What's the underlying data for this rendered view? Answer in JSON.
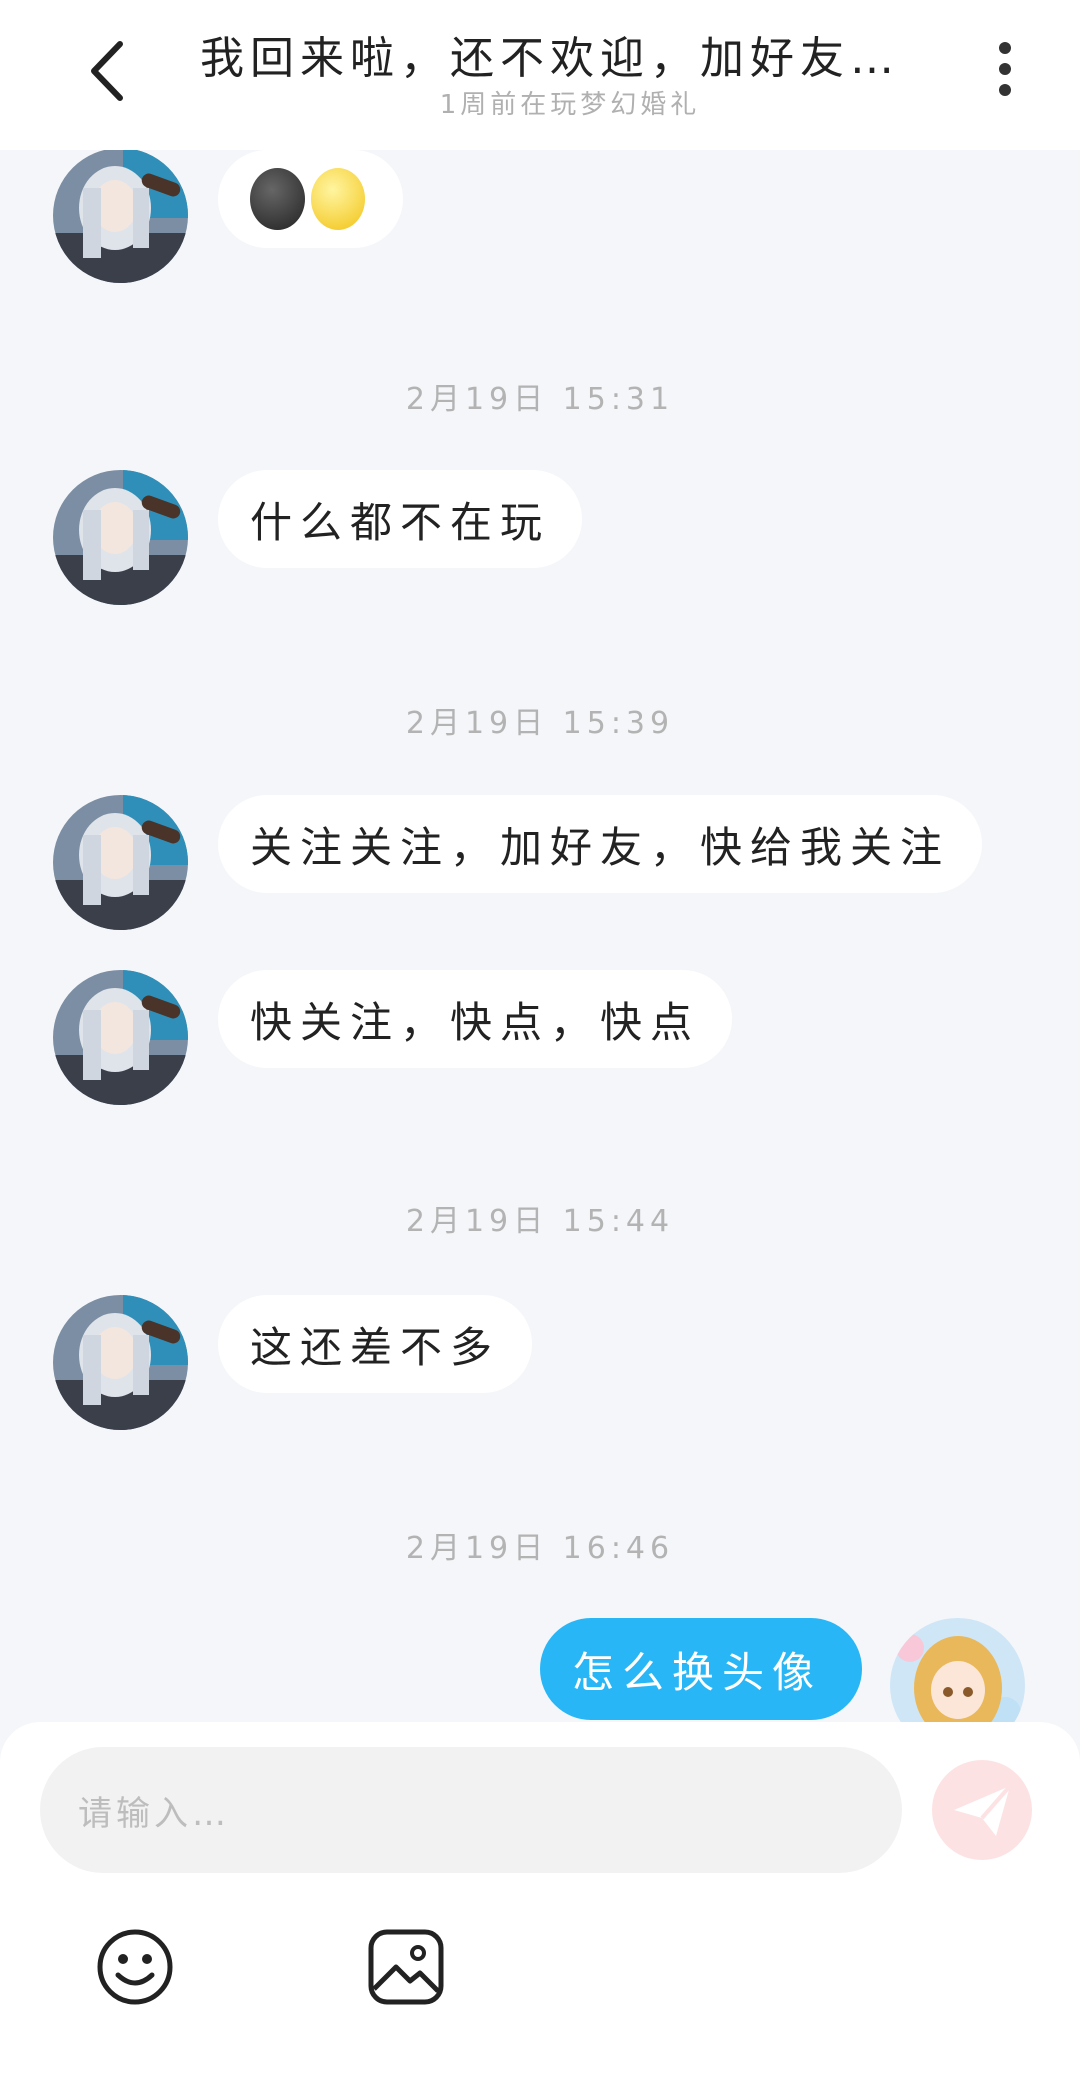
{
  "header": {
    "title": "我回来啦，还不欢迎，加好友要…",
    "subtitle": "1周前在玩梦幻婚礼"
  },
  "messages": {
    "m0": {
      "emoji": [
        "🌚",
        "🌝"
      ]
    },
    "t1": "2月19日 15:31",
    "m1": "什么都不在玩",
    "t2": "2月19日 15:39",
    "m2": "关注关注，加好友，快给我关注",
    "m3": "快关注，快点，快点",
    "t3": "2月19日 15:44",
    "m4": "这还差不多",
    "t4": "2月19日 16:46",
    "m5": "怎么换头像"
  },
  "composer": {
    "placeholder": "请输入…"
  },
  "colors": {
    "accent": "#29b6f6",
    "send_button": "#fde2e3",
    "background": "#f4f6f9"
  }
}
